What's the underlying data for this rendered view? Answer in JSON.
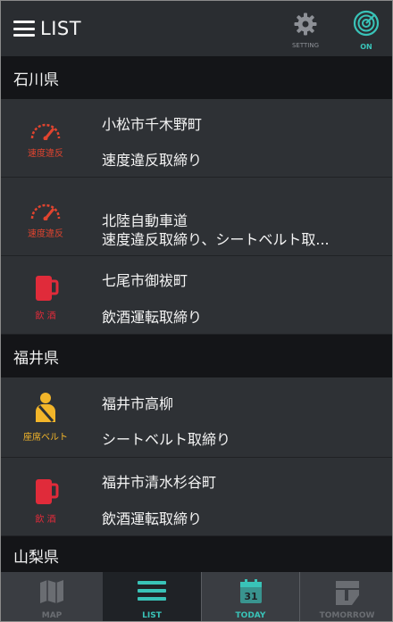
{
  "header": {
    "title": "LIST",
    "setting_label": "SETTING",
    "on_label": "ON"
  },
  "colors": {
    "speed": "#e0442f",
    "drink": "#e02b3a",
    "belt": "#f2b52a",
    "accent": "#39c3b8"
  },
  "sections": [
    {
      "name": "石川県"
    },
    {
      "name": "福井県"
    },
    {
      "name": "山梨県"
    }
  ],
  "rows": [
    {
      "location": "小松市千木野町",
      "violation": "速度違反取締り",
      "icon": "speedometer-icon",
      "icon_caption": "速度違反"
    },
    {
      "location": "北陸自動車道",
      "violation": "速度違反取締り、シートベルト取...",
      "icon": "speedometer-icon",
      "icon_caption": "速度違反"
    },
    {
      "location": "七尾市御祓町",
      "violation": "飲酒運転取締り",
      "icon": "beer-mug-icon",
      "icon_caption": "飲 酒"
    },
    {
      "location": "福井市高柳",
      "violation": "シートベルト取締り",
      "icon": "seatbelt-icon",
      "icon_caption": "座席ベルト"
    },
    {
      "location": "福井市清水杉谷町",
      "violation": "飲酒運転取締り",
      "icon": "beer-mug-icon",
      "icon_caption": "飲 酒"
    }
  ],
  "tabs": [
    {
      "label": "MAP",
      "icon": "map-icon",
      "active": false
    },
    {
      "label": "LIST",
      "icon": "list-icon",
      "active": true
    },
    {
      "label": "TODAY",
      "icon": "calendar-icon",
      "active": false,
      "day": "31"
    },
    {
      "label": "TOMORROW",
      "icon": "calendar-flip-icon",
      "active": false
    }
  ]
}
